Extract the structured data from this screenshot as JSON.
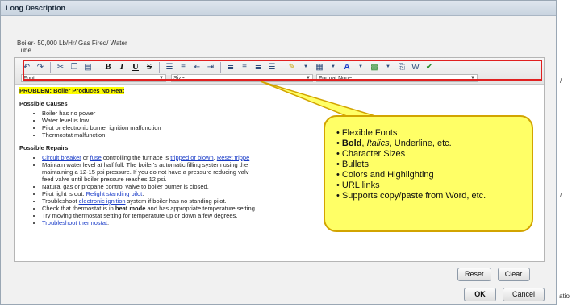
{
  "dialog": {
    "title": "Long Description"
  },
  "header": {
    "subtitle_line1": "Boiler- 50,000 Lb/Hr/ Gas Fired/ Water",
    "subtitle_line2": "Tube"
  },
  "toolbar": {
    "icons": [
      "undo-icon",
      "redo-icon",
      "cut-icon",
      "copy-icon",
      "paste-icon",
      "bold-icon",
      "italic-icon",
      "underline-icon",
      "strikethrough-icon",
      "ordered-list-icon",
      "unordered-list-icon",
      "outdent-icon",
      "indent-icon",
      "align-left-icon",
      "align-center-icon",
      "align-right-icon",
      "justify-icon",
      "highlight-icon",
      "table-icon",
      "font-color-icon",
      "background-color-icon",
      "insert-link-icon",
      "paste-word-icon",
      "spellcheck-icon"
    ],
    "bold_label": "B",
    "italic_label": "I",
    "underline_label": "U",
    "strike_label": "S",
    "font_label": "Font",
    "size_label": "Size",
    "format_label": "Format",
    "format_value": "None"
  },
  "content": {
    "problem": "PROBLEM: Boiler Produces No Heat",
    "causes_heading": "Possible Causes",
    "causes": [
      "Boiler has no power",
      "Water level is low",
      "Pilot or electronic burner ignition malfunction",
      "Thermostat malfunction"
    ],
    "repairs_heading": "Possible Repairs",
    "repair1": {
      "link1": "Circuit breaker",
      "t1": " or ",
      "link2": "fuse",
      "t2": " controlling the furnace is ",
      "link3": "tripped or blown",
      "t3": ". ",
      "link4": "Reset trippe"
    },
    "repair2a": "Maintain water level at half full. The boiler's automatic filling system using the",
    "repair2b": "maintaining a 12-15 psi pressure. If you do not have a pressure reducing valv",
    "repair2c": "feed valve until boiler pressure reaches 12 psi.",
    "repair3": "Natural gas or propane control valve to boiler burner is closed.",
    "repair4": {
      "t1": "Pilot light is out. ",
      "link": "Relight standing pilot",
      "t2": "."
    },
    "repair5": {
      "t1": "Troubleshoot ",
      "link": "electronic ignition",
      "t2": " system if boiler has no standing pilot."
    },
    "repair6": {
      "t1": "Check that thermostat is in ",
      "bold": "heat mode",
      "t2": " and has appropriate temperature setting."
    },
    "repair7": "Try moving thermostat setting for temperature up or down a few degrees.",
    "repair8": {
      "link": "Troubleshoot thermostat",
      "t2": "."
    }
  },
  "callout": {
    "items": [
      "Flexible Fonts",
      "Character Sizes",
      "Bullets",
      "Colors and Highlighting",
      "URL links",
      "Supports copy/paste from Word, etc."
    ],
    "bold": "Bold",
    "italics": "Italics",
    "underline": "Underline",
    "etc": ", etc."
  },
  "buttons": {
    "reset": "Reset",
    "clear": "Clear",
    "ok": "OK",
    "cancel": "Cancel"
  },
  "edge": {
    "right_text": "atio",
    "right_mark": "/"
  },
  "colors": {
    "highlight": "#ffff00",
    "callout_bg": "#ffff66",
    "toolbar_border": "#e02020",
    "link": "#1a3cc8"
  }
}
